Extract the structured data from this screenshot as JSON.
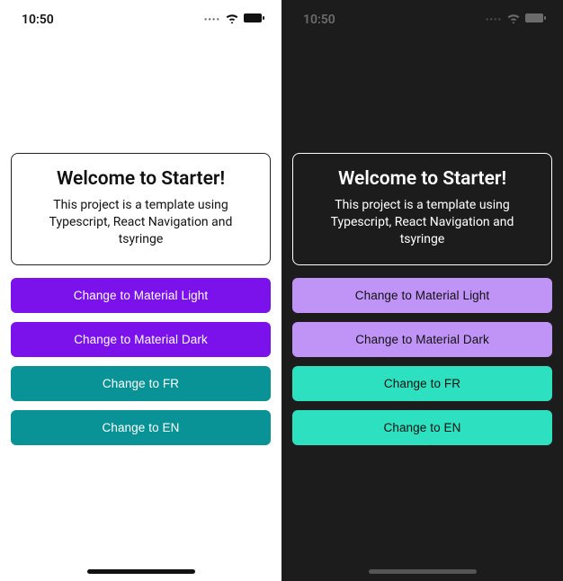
{
  "status": {
    "time": "10:50"
  },
  "light": {
    "title": "Welcome to Starter!",
    "subtitle": "This project is a template using Typescript, React Navigation and tsyringe",
    "buttons": {
      "materialLight": "Change to Material Light",
      "materialDark": "Change to Material Dark",
      "changeFr": "Change to FR",
      "changeEn": "Change to EN"
    }
  },
  "dark": {
    "title": "Welcome to Starter!",
    "subtitle": "This project is a template using Typescript, React Navigation and tsyringe",
    "buttons": {
      "materialLight": "Change to Material Light",
      "materialDark": "Change to Material Dark",
      "changeFr": "Change to FR",
      "changeEn": "Change to EN"
    }
  }
}
